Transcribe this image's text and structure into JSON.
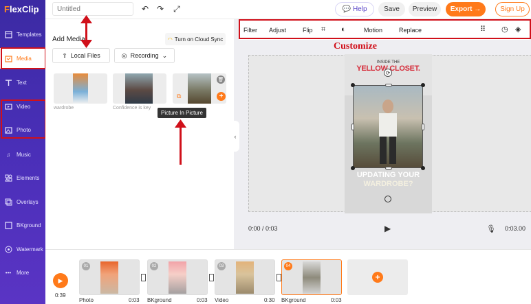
{
  "app": {
    "logo_accent": "F",
    "logo_rest": "lexClip"
  },
  "sidebar": {
    "items": [
      {
        "label": "Templates",
        "icon": "template-icon"
      },
      {
        "label": "Media",
        "icon": "media-icon"
      },
      {
        "label": "Text",
        "icon": "text-icon"
      },
      {
        "label": "Video",
        "icon": "video-icon"
      },
      {
        "label": "Photo",
        "icon": "photo-icon"
      },
      {
        "label": "Music",
        "icon": "music-icon"
      },
      {
        "label": "Elements",
        "icon": "elements-icon"
      },
      {
        "label": "Overlays",
        "icon": "overlays-icon"
      },
      {
        "label": "BKground",
        "icon": "background-icon"
      },
      {
        "label": "Watermark",
        "icon": "watermark-icon"
      },
      {
        "label": "More",
        "icon": "more-icon"
      }
    ],
    "active": "Media"
  },
  "topbar": {
    "title_placeholder": "Untitled",
    "help": "Help",
    "save": "Save",
    "preview": "Preview",
    "export": "Export",
    "signup": "Sign Up"
  },
  "media": {
    "heading": "Add Media",
    "cloud_sync": "Turn on Cloud Sync",
    "local_files": "Local Files",
    "recording": "Recording",
    "thumbs": [
      {
        "label": "wardrobe"
      },
      {
        "label": "Confidence is key"
      },
      {
        "label": ""
      }
    ],
    "tooltip": "Picture In Picture"
  },
  "toolbar": {
    "filter": "Filter",
    "adjust": "Adjust",
    "flip": "Flip",
    "motion": "Motion",
    "replace": "Replace"
  },
  "annotation": "Customize",
  "phone": {
    "small": "INSIDE THE",
    "big": "YELLOW CLOSET.",
    "headline1": "UPDATING YOUR",
    "headline2": "WARDROBE?"
  },
  "player": {
    "current": "0:00 / 0:03",
    "total": "0:03.00"
  },
  "timeline": {
    "total": "0:39",
    "clips": [
      {
        "num": "01",
        "name": "Photo",
        "dur": "0:03"
      },
      {
        "num": "02",
        "name": "BKground",
        "dur": "0:03"
      },
      {
        "num": "03",
        "name": "Video",
        "dur": "0:30"
      },
      {
        "num": "04",
        "name": "BKground",
        "dur": "0:03"
      }
    ]
  },
  "colors": {
    "accent": "#ff7a1a",
    "sidebar": "#4a2fb8",
    "annotation": "#d0101a"
  }
}
